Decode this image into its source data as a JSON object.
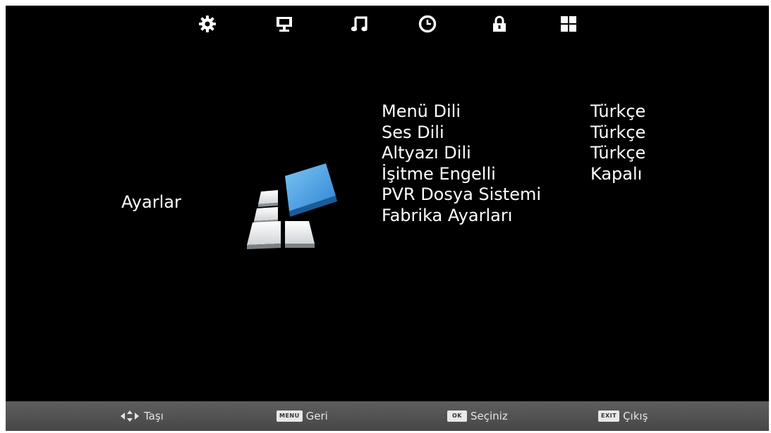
{
  "top_tabs": [
    {
      "icon": "gear-icon",
      "name": "settings"
    },
    {
      "icon": "monitor-icon",
      "name": "picture"
    },
    {
      "icon": "music-note-icon",
      "name": "sound"
    },
    {
      "icon": "clock-icon",
      "name": "time"
    },
    {
      "icon": "lock-icon",
      "name": "lock"
    },
    {
      "icon": "grid-icon",
      "name": "apps"
    }
  ],
  "page_title": "Ayarlar",
  "menu_items": [
    {
      "label": "Menü Dili",
      "value": "Türkçe"
    },
    {
      "label": "Ses Dili",
      "value": "Türkçe"
    },
    {
      "label": "Altyazı Dili",
      "value": "Türkçe"
    },
    {
      "label": "İşitme Engelli",
      "value": "Kapalı"
    },
    {
      "label": "PVR Dosya Sistemi",
      "value": ""
    },
    {
      "label": "Fabrika Ayarları",
      "value": ""
    }
  ],
  "bottom_hints": {
    "move": {
      "label": "Taşı"
    },
    "back": {
      "key": "MENU",
      "label": "Geri"
    },
    "select": {
      "key": "OK",
      "label": "Seçiniz"
    },
    "exit": {
      "key": "EXIT",
      "label": "Çıkış"
    }
  },
  "colors": {
    "background": "#000000",
    "text": "#ffffff",
    "bottom_bar": "#555555",
    "accent_blue": "#3b8fd8"
  }
}
